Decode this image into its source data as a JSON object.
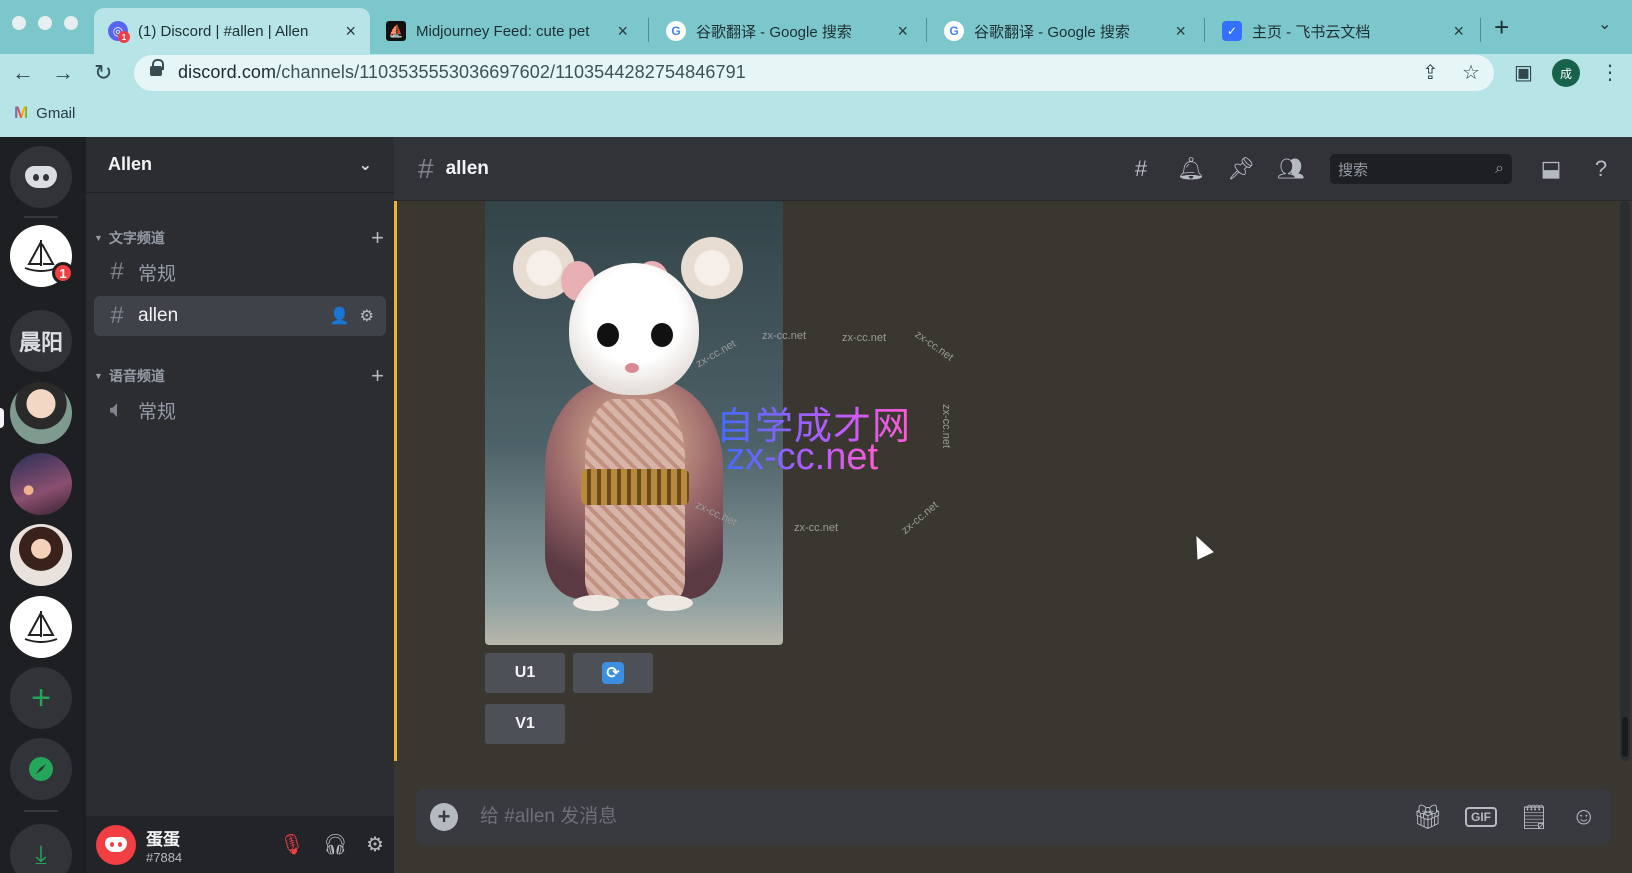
{
  "browser": {
    "tabs": [
      {
        "title": "(1) Discord | #allen | Allen",
        "favicon_color": "#5865f2",
        "active": true
      },
      {
        "title": "Midjourney Feed: cute pet",
        "favicon_color": "#111111"
      },
      {
        "title": "谷歌翻译 - Google 搜索",
        "favicon_color": "#4285f4"
      },
      {
        "title": "谷歌翻译 - Google 搜索",
        "favicon_color": "#4285f4"
      },
      {
        "title": "主页 - 飞书云文档",
        "favicon_color": "#3370ff"
      }
    ],
    "url_host": "discord.com",
    "url_path": "/channels/1103535553036697602/1103544282754846791",
    "profile_initial": "成",
    "bookmarks": [
      {
        "label": "Gmail"
      }
    ]
  },
  "discord": {
    "home_badge": "1",
    "guild_text": "晨阳",
    "server_name": "Allen",
    "categories": [
      {
        "label": "文字频道",
        "channels": [
          {
            "name": "常规"
          },
          {
            "name": "allen",
            "active": true
          }
        ]
      },
      {
        "label": "语音频道",
        "channels": [
          {
            "name": "常规"
          }
        ]
      }
    ],
    "current_channel": "allen",
    "search_placeholder": "搜索",
    "user": {
      "name": "蛋蛋",
      "tag": "#7884"
    },
    "buttons": {
      "u1": "U1",
      "v1": "V1"
    },
    "composer_placeholder": "给 #allen 发消息",
    "gif_label": "GIF",
    "accent_color": "#f0b232"
  },
  "watermark": {
    "line1": "自学成才网",
    "line2": "zx-cc.net",
    "small": "zx-cc.net"
  }
}
